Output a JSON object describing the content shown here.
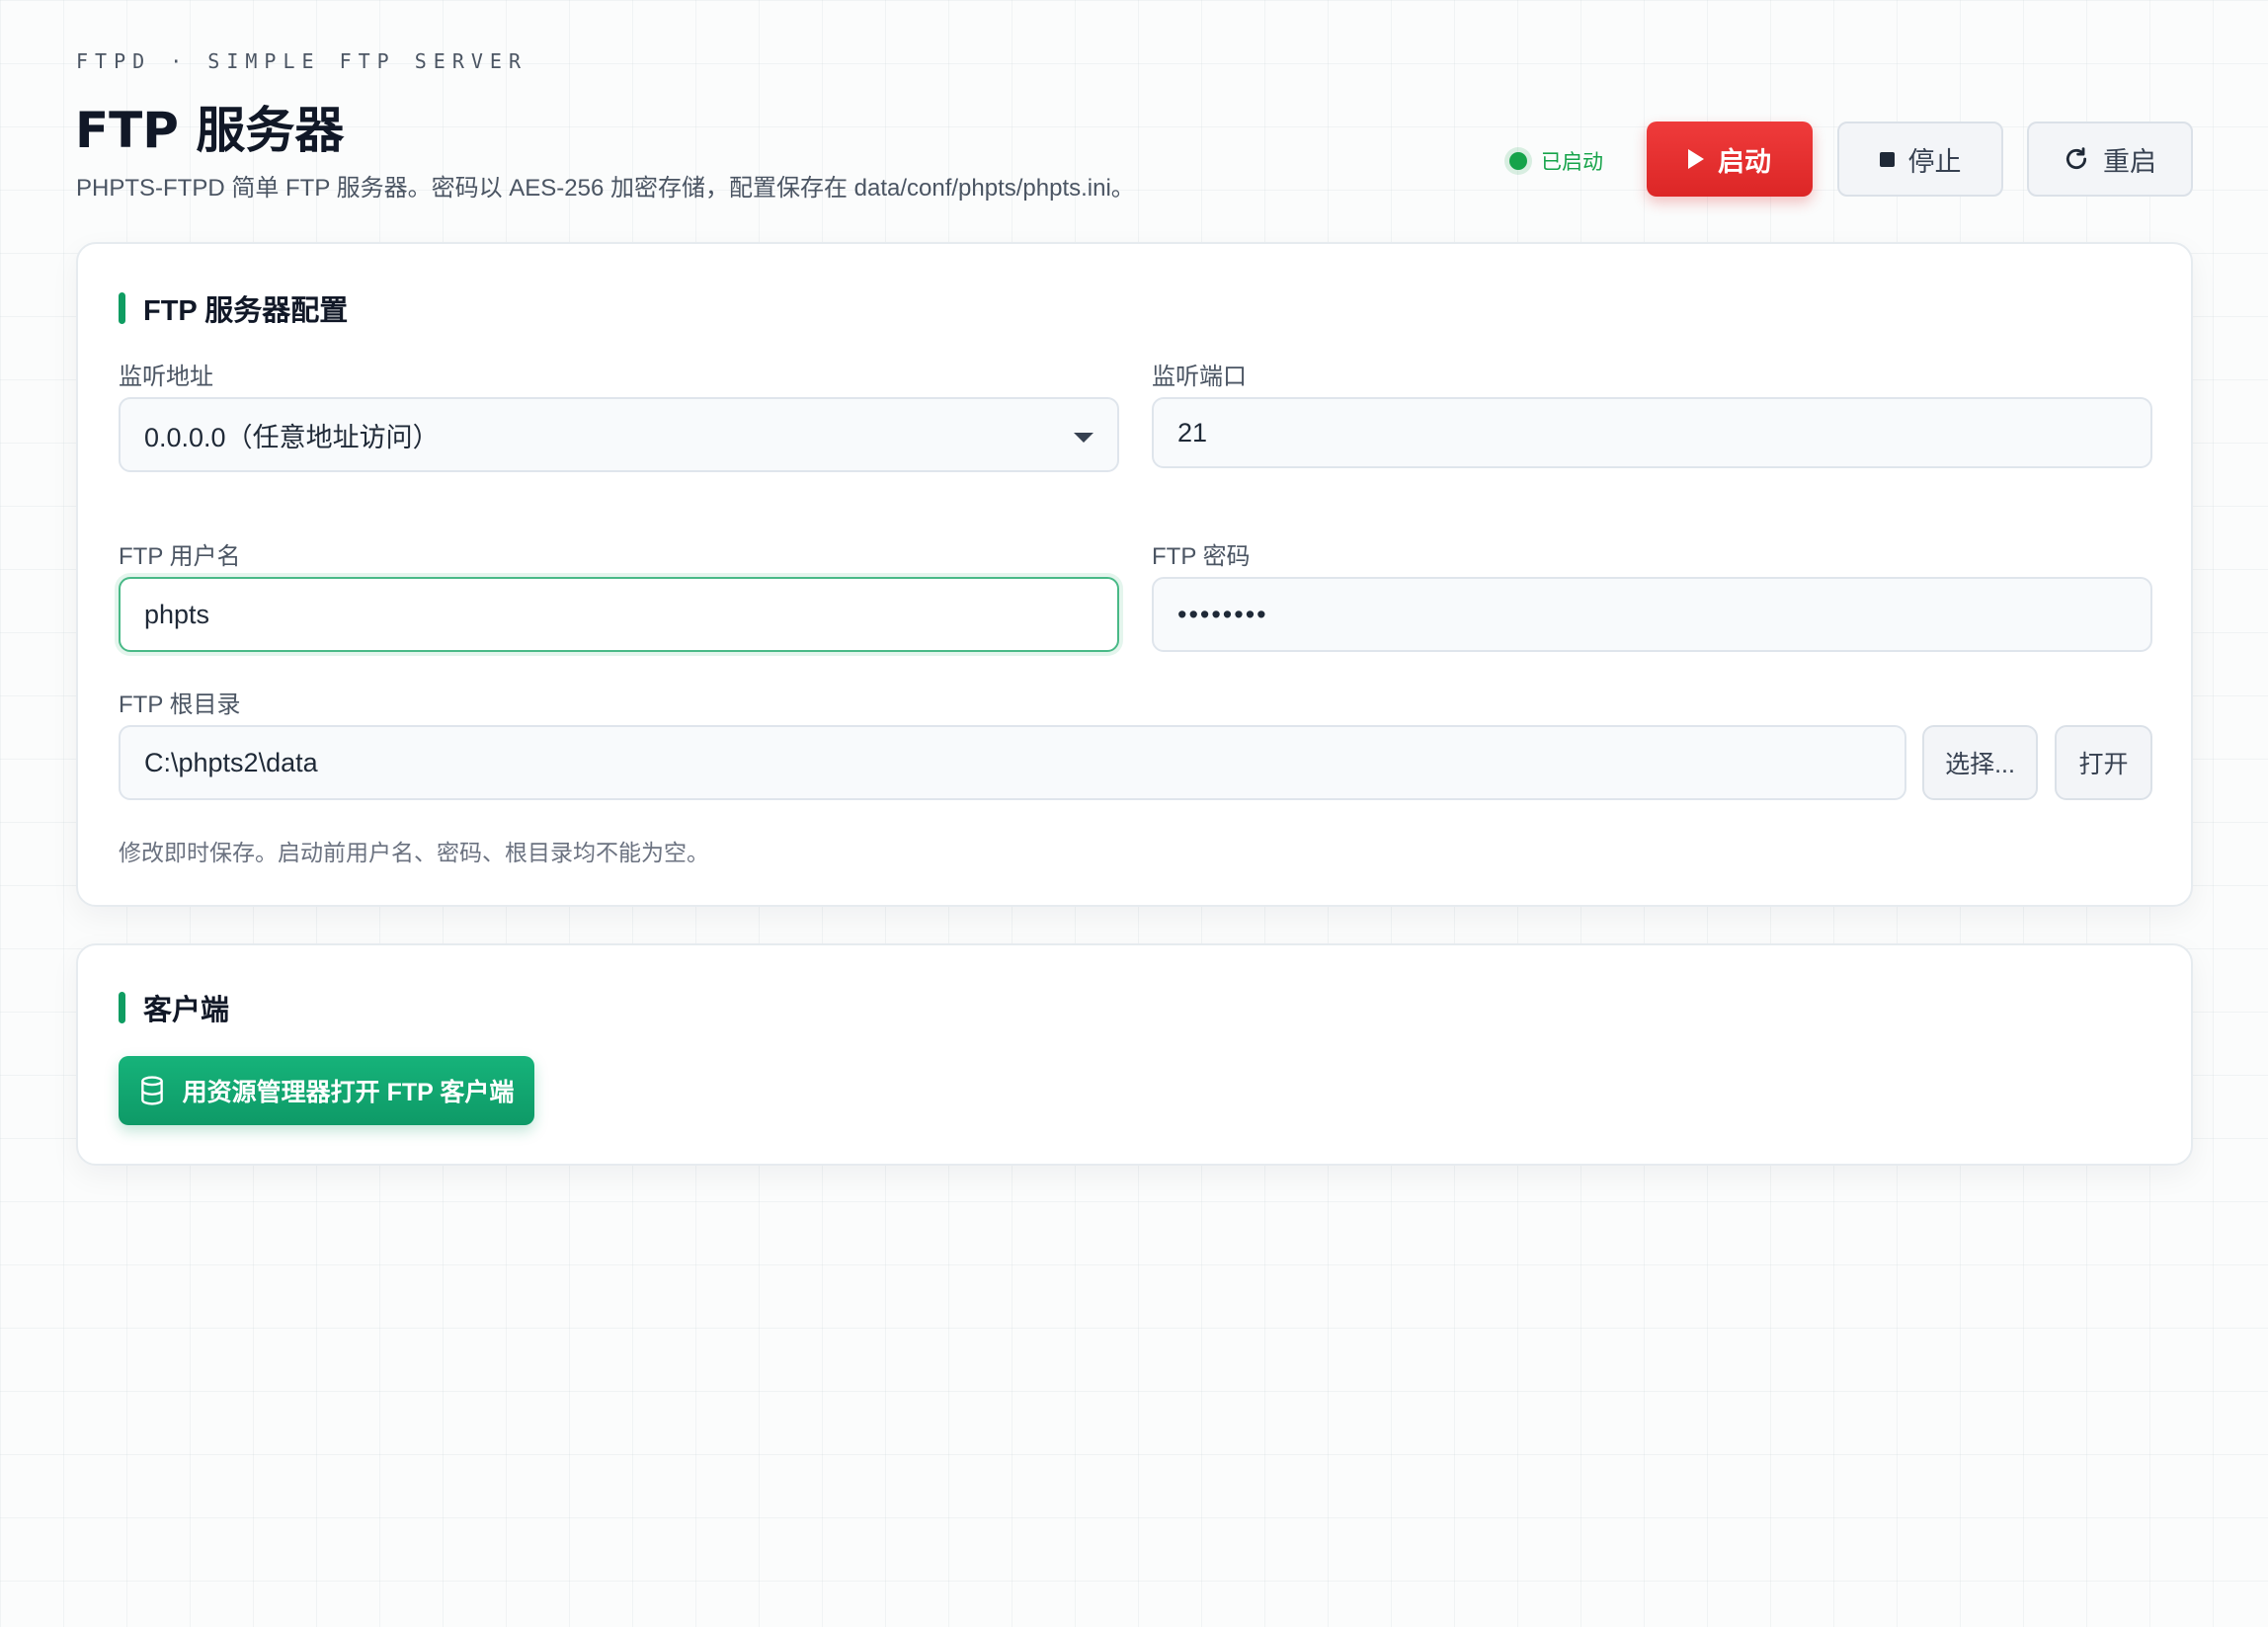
{
  "header": {
    "eyebrow": "FTPD · SIMPLE FTP SERVER",
    "title": "FTP 服务器",
    "subtitle": "PHPTS-FTPD 简单 FTP 服务器。密码以 AES-256 加密存储，配置保存在 data/conf/phpts/phpts.ini。"
  },
  "status": {
    "label": "已启动",
    "color": "#16a34a"
  },
  "toolbar": {
    "start_label": "启动",
    "stop_label": "停止",
    "restart_label": "重启",
    "start_color": "#dc2626"
  },
  "config": {
    "title": "FTP 服务器配置",
    "listen_address": {
      "label": "监听地址",
      "value": "0.0.0.0（任意地址访问）"
    },
    "listen_port": {
      "label": "监听端口",
      "value": "21"
    },
    "username": {
      "label": "FTP 用户名",
      "value": "phpts"
    },
    "password": {
      "label": "FTP 密码",
      "value": "••••••••"
    },
    "root_dir": {
      "label": "FTP 根目录",
      "value": "C:\\phpts2\\data",
      "choose_label": "选择...",
      "open_label": "打开"
    },
    "hint": "修改即时保存。启动前用户名、密码、根目录均不能为空。"
  },
  "client": {
    "title": "客户端",
    "open_explorer_label": "用资源管理器打开 FTP 客户端",
    "accent": "#0f9d62"
  }
}
